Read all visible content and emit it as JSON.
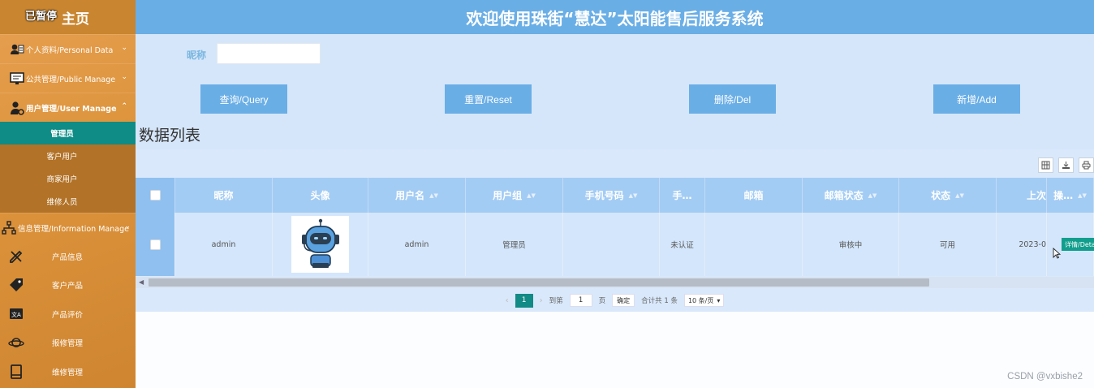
{
  "sidebar": {
    "paused_label": "已暂停",
    "home_label": "主页",
    "groups": [
      {
        "label": "个人资料/Personal Data",
        "icon": "person-card-icon"
      },
      {
        "label": "公共管理/Public Manage",
        "icon": "monitor-icon"
      },
      {
        "label": "用户管理/User Manage",
        "icon": "user-gear-icon"
      }
    ],
    "user_sub": [
      "管理员",
      "客户用户",
      "商家用户",
      "维修人员"
    ],
    "info_group": {
      "label": "信息管理/Information Manage",
      "icon": "hierarchy-icon"
    },
    "info_items": [
      {
        "label": "产品信息",
        "icon": "pencil-ruler-icon"
      },
      {
        "label": "客户产品",
        "icon": "tag-icon"
      },
      {
        "label": "产品评价",
        "icon": "translate-icon"
      },
      {
        "label": "报修管理",
        "icon": "planet-icon"
      },
      {
        "label": "维修管理",
        "icon": "book-icon"
      }
    ]
  },
  "header": {
    "title": "欢迎使用珠街“慧达”太阳能售后服务系统"
  },
  "filter": {
    "nickname_label": "昵称",
    "nickname_value": ""
  },
  "buttons": {
    "query": "查询/Query",
    "reset": "重置/Reset",
    "delete": "删除/Del",
    "add": "新增/Add"
  },
  "list_title": "数据列表",
  "table": {
    "columns": [
      "昵称",
      "头像",
      "用户名",
      "用户组",
      "手机号码",
      "手…",
      "邮箱",
      "邮箱状态",
      "状态",
      "上次",
      "操…"
    ],
    "row": {
      "nickname": "admin",
      "username": "admin",
      "group": "管理员",
      "phone": "",
      "phone_status": "未认证",
      "email": "",
      "email_status": "审核中",
      "status": "可用",
      "last": "2023-0",
      "action": "详情/Detail"
    }
  },
  "pagination": {
    "current": "1",
    "goto_label": "到第",
    "goto_value": "1",
    "page_unit": "页",
    "confirm": "确定",
    "total": "合计共 1 条",
    "page_size": "10 条/页"
  },
  "watermark": "CSDN @vxbishe2",
  "colors": {
    "header": "#6aaee6",
    "sidebar": "#dd943c",
    "accent_teal": "#128a85"
  }
}
